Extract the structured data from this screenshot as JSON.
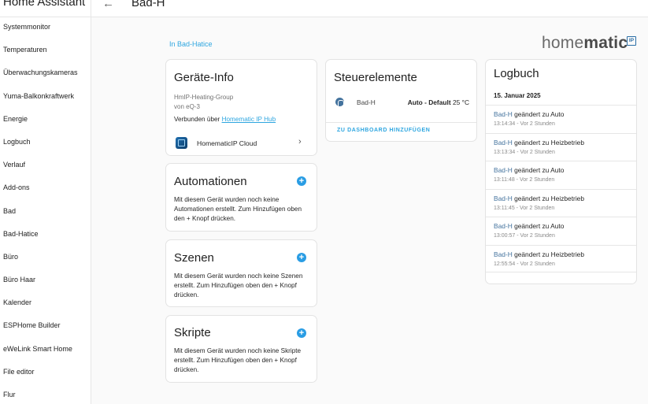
{
  "app": {
    "title": "Home Assistant"
  },
  "sidebar": {
    "items": [
      {
        "label": "Systemmonitor"
      },
      {
        "label": "Temperaturen"
      },
      {
        "label": "Überwachungskameras"
      },
      {
        "label": "Yuma-Balkonkraftwerk"
      },
      {
        "label": "Energie"
      },
      {
        "label": "Logbuch"
      },
      {
        "label": "Verlauf"
      },
      {
        "label": "Add-ons"
      },
      {
        "label": "Bad"
      },
      {
        "label": "Bad-Hatice"
      },
      {
        "label": "Büro"
      },
      {
        "label": "Büro Haar"
      },
      {
        "label": "Kalender"
      },
      {
        "label": "ESPHome Builder"
      },
      {
        "label": "eWeLink Smart Home"
      },
      {
        "label": "File editor"
      },
      {
        "label": "Flur"
      }
    ]
  },
  "header": {
    "back_icon": "arrow-left-icon",
    "title": "Bad-H"
  },
  "breadcrumb": {
    "area": "In Bad-Hatice"
  },
  "brand": {
    "prefix": "home",
    "bold": "matic",
    "badge": "IP"
  },
  "device_info": {
    "title": "Geräte-Info",
    "model": "HmIP-Heating-Group",
    "manufacturer": "von eQ-3",
    "connected_prefix": "Verbunden über",
    "connected_link": "Homematic IP Hub",
    "integration": {
      "icon": "homematic-cloud-icon",
      "label": "HomematicIP Cloud",
      "chevron": "›"
    }
  },
  "automations": {
    "title": "Automationen",
    "add_icon": "+",
    "text": "Mit diesem Gerät wurden noch keine Automationen erstellt. Zum Hinzufügen oben den + Knopf drücken."
  },
  "scenes": {
    "title": "Szenen",
    "add_icon": "+",
    "text": "Mit diesem Gerät wurden noch keine Szenen erstellt. Zum Hinzufügen oben den + Knopf drücken."
  },
  "scripts": {
    "title": "Skripte",
    "add_icon": "+",
    "text": "Mit diesem Gerät wurden noch keine Skripte erstellt. Zum Hinzufügen oben den + Knopf drücken."
  },
  "controls": {
    "title": "Steuerelemente",
    "entity": {
      "icon": "thermostat-icon",
      "name": "Bad-H",
      "state_bold": "Auto - Default",
      "state_value": "25 °C"
    },
    "action": "ZU DASHBOARD HINZUFÜGEN"
  },
  "logbook": {
    "title": "Logbuch",
    "date": "15. Januar 2025",
    "entries": [
      {
        "entity": "Bad-H",
        "message": "geändert zu Auto",
        "time": "13:14:34 - Vor 2 Stunden"
      },
      {
        "entity": "Bad-H",
        "message": "geändert zu Heizbetrieb",
        "time": "13:13:34 - Vor 2 Stunden"
      },
      {
        "entity": "Bad-H",
        "message": "geändert zu Auto",
        "time": "13:11:48 - Vor 2 Stunden"
      },
      {
        "entity": "Bad-H",
        "message": "geändert zu Heizbetrieb",
        "time": "13:11:45 - Vor 2 Stunden"
      },
      {
        "entity": "Bad-H",
        "message": "geändert zu Auto",
        "time": "13:00:57 - Vor 2 Stunden"
      },
      {
        "entity": "Bad-H",
        "message": "geändert zu Heizbetrieb",
        "time": "12:55:54 - Vor 2 Stunden"
      }
    ]
  }
}
